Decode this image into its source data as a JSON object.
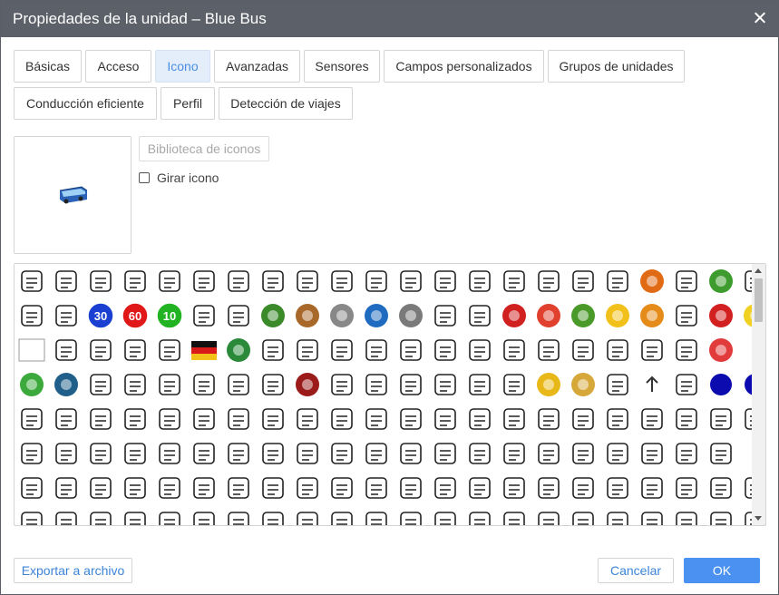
{
  "dialog": {
    "title": "Propiedades de la unidad – Blue Bus",
    "close_icon": "close-icon"
  },
  "tabs": [
    {
      "id": "basicas",
      "label": "Básicas",
      "active": false
    },
    {
      "id": "acceso",
      "label": "Acceso",
      "active": false
    },
    {
      "id": "icono",
      "label": "Icono",
      "active": true
    },
    {
      "id": "avanzadas",
      "label": "Avanzadas",
      "active": false
    },
    {
      "id": "sensores",
      "label": "Sensores",
      "active": false
    },
    {
      "id": "campos",
      "label": "Campos personalizados",
      "active": false
    },
    {
      "id": "grupos",
      "label": "Grupos de unidades",
      "active": false
    },
    {
      "id": "conduccion",
      "label": "Conducción eficiente",
      "active": false
    },
    {
      "id": "perfil",
      "label": "Perfil",
      "active": false
    },
    {
      "id": "deteccion",
      "label": "Detección de viajes",
      "active": false
    }
  ],
  "icon_tab": {
    "preview_icon": "blue-bus-icon",
    "library_button": "Biblioteca de iconos",
    "rotate_label": "Girar icono",
    "rotate_checked": false
  },
  "gallery": {
    "rows": [
      [
        "plant",
        "wedding-arch",
        "bride",
        "wedding-cake",
        "calendar-heart",
        "bride-dress",
        "flowers",
        "champagne-glasses",
        "heart",
        "love-letter",
        "location-heart",
        "microphone",
        "music-note",
        "notebook",
        "camera",
        "doctor",
        "ring",
        "movie-camera",
        "orange-excavator",
        "black-jet",
        "green-tank-target",
        "warehouse-building"
      ],
      [
        "rabbit",
        "green-harvester",
        "speed-limit-30",
        "speed-limit-60",
        "speed-limit-10",
        "green-frog",
        "military-truck",
        "green-tractor",
        "cow",
        "cat",
        "robot-badge",
        "seal",
        "black-car-top",
        "dark-car",
        "fire-truck",
        "chrome-logo",
        "green-octopus",
        "yellow-school-bus",
        "orange-truck",
        "gentleman",
        "red-car-top",
        "minion"
      ],
      [
        "broken-image",
        "tank-convoy",
        "tank-convoy",
        "tank-convoy",
        "plant-small",
        "germany-flag",
        "ambulance",
        "usa-eagle-flag",
        "green-route",
        "database-add",
        "footprints",
        "woman-avatar",
        "boy-avatar",
        "tea-cup",
        "family",
        "blue-car",
        "map-tile",
        "grapes",
        "skull",
        "red-lizard",
        "red-lock"
      ],
      [
        "green-lock-open",
        "blue-truck-badge",
        "sparkle",
        "person-reading",
        "envelope",
        "movie-camera",
        "wifi-wave",
        "striped-flag",
        "radiation",
        "nun",
        "id-card",
        "reindeer",
        "first-aid-kit",
        "rocket",
        "sprout",
        "yellow-loader",
        "hedgehog",
        "game-character",
        "arrow-up",
        "penguin",
        "blue-dot",
        "blue-dot"
      ],
      [
        "santa",
        "flask",
        "books",
        "brain",
        "calendar",
        "trophy",
        "badge-percent",
        "presentation-board",
        "glasses",
        "people-group",
        "graduation-cap",
        "hourglass",
        "light-bulb",
        "clipboard",
        "map-pin",
        "envelope",
        "smartphone",
        "wallet",
        "person-desk",
        "graduate",
        "stopwatch",
        "chat-bubbles"
      ],
      [
        "calendar-grid",
        "armchair",
        "globe",
        "headset-agent",
        "graduation-cap",
        "envelope",
        "magnifier",
        "phone-call",
        "notebook",
        "clock-chart",
        "wallet",
        "hourglass",
        "speedometer",
        "star",
        "flowchart",
        "target",
        "video-player",
        "webcam",
        "shopping-bag",
        "package-box",
        "credit-card"
      ],
      [
        "shopping-cart",
        "calculator",
        "percent-badge",
        "discount-tag",
        "clapping-hands",
        "person-hat",
        "at-sign",
        "person-avatar",
        "map-landscape",
        "cash-stack",
        "percent-100",
        "smartphone",
        "recycle",
        "clock-24",
        "shop",
        "delivery-truck",
        "person-circle",
        "balloons",
        "cake-slice",
        "calendar-grid",
        "cocktail",
        "couple"
      ],
      [
        "disco-ball",
        "coffee-mug",
        "document",
        "envelope",
        "map-pin",
        "magic-wand",
        "chef",
        "microphone",
        "music-note",
        "wave",
        "gift",
        "smartphone",
        "smiley",
        "sun",
        "movie-camera",
        "speech-bubble",
        "hands",
        "person",
        "cone",
        "lipstick",
        "coffee",
        "badge"
      ]
    ]
  },
  "footer": {
    "export_label": "Exportar a archivo",
    "cancel_label": "Cancelar",
    "ok_label": "OK"
  },
  "colors": {
    "title_bar": "#5c6068",
    "accent": "#4b91f1",
    "active_tab_bg": "#e4eefb",
    "active_tab_text": "#4a8ee0"
  }
}
